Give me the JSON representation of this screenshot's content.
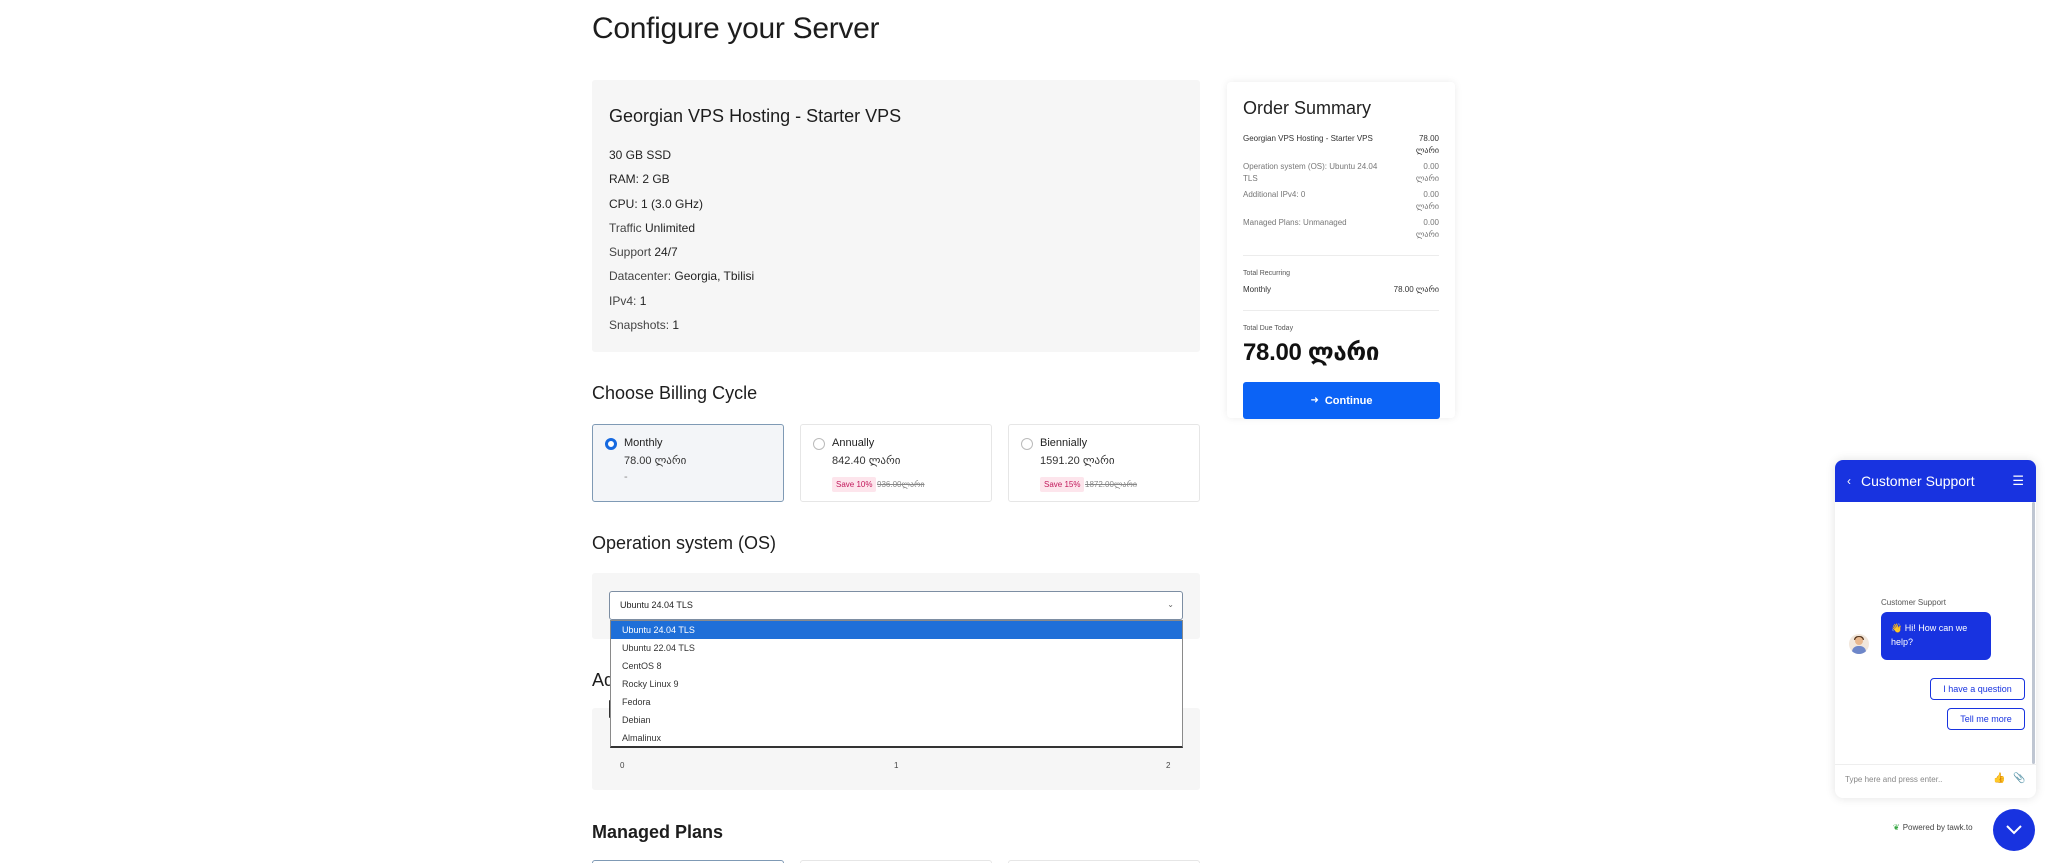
{
  "page": {
    "title": "Configure your Server"
  },
  "product": {
    "name": "Georgian VPS Hosting - Starter VPS",
    "specs": [
      {
        "key": "",
        "value": "30 GB SSD"
      },
      {
        "key": "",
        "value": "RAM: 2 GB"
      },
      {
        "key": "",
        "value": "CPU: 1 (3.0 GHz)"
      },
      {
        "key": "Traffic",
        "value": "Unlimited"
      },
      {
        "key": "Support",
        "value": "24/7"
      },
      {
        "key": "Datacenter:",
        "value": "Georgia, Tbilisi"
      },
      {
        "key": "IPv4:",
        "value": "1"
      },
      {
        "key": "Snapshots:",
        "value": "1"
      }
    ]
  },
  "billing": {
    "heading": "Choose Billing Cycle",
    "options": [
      {
        "name": "Monthly",
        "price": "78.00 ლარი",
        "note": "-",
        "save": "",
        "old_price": "",
        "selected": true
      },
      {
        "name": "Annually",
        "price": "842.40 ლარი",
        "note": "",
        "save": "Save 10%",
        "old_price": "936.00ლარი",
        "selected": false
      },
      {
        "name": "Biennially",
        "price": "1591.20 ლარი",
        "note": "",
        "save": "Save 15%",
        "old_price": "1872.00ლარი",
        "selected": false
      }
    ]
  },
  "os": {
    "heading": "Operation system (OS)",
    "selected": "Ubuntu 24.04 TLS",
    "options": [
      "Ubuntu 24.04 TLS",
      "Ubuntu 22.04 TLS",
      "CentOS 8",
      "Rocky Linux 9",
      "Fedora",
      "Debian",
      "Almalinux"
    ]
  },
  "ipv4": {
    "heading_visible": "Ad",
    "ticks": [
      "0",
      "1",
      "2"
    ],
    "value": 0
  },
  "managed": {
    "heading": "Managed Plans"
  },
  "summary": {
    "title": "Order Summary",
    "lines": [
      {
        "label": "Georgian VPS Hosting - Starter VPS",
        "amount": "78.00 ლარი"
      },
      {
        "label": "Operation system (OS): Ubuntu 24.04 TLS",
        "amount": "0.00 ლარი"
      },
      {
        "label": "Additional IPv4: 0",
        "amount": "0.00 ლარი"
      },
      {
        "label": "Managed Plans: Unmanaged",
        "amount": "0.00 ლარი"
      }
    ],
    "recurring_label": "Total Recurring",
    "recurring_period": "Monthly",
    "recurring_amount": "78.00 ლარი",
    "total_label": "Total Due Today",
    "total_amount": "78.00 ლარი",
    "continue_label": "Continue"
  },
  "chat": {
    "title": "Customer Support",
    "agent": "Customer Support",
    "message": "👋 Hi! How can we help?",
    "buttons": [
      "I have a question",
      "Tell me more"
    ],
    "input_placeholder": "Type here and press enter..",
    "powered_by": "Powered by tawk.to"
  },
  "colors": {
    "accent": "#0b63f6",
    "chat": "#1833e0",
    "selected_option": "#1f6fd8",
    "save_badge_bg": "#fde5ec",
    "save_badge_text": "#c2185b"
  }
}
